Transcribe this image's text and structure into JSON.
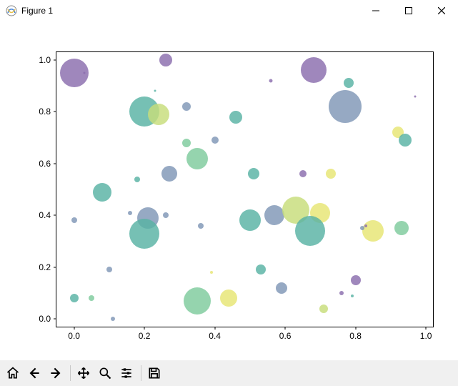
{
  "window": {
    "title": "Figure 1",
    "controls": {
      "minimize": "minimize",
      "maximize": "maximize",
      "close": "close"
    }
  },
  "toolbar": {
    "home": "home-icon",
    "back": "back-icon",
    "forward": "forward-icon",
    "pan": "pan-icon",
    "zoom": "zoom-icon",
    "subplots": "subplots-icon",
    "save": "save-icon"
  },
  "chart_data": {
    "type": "scatter",
    "xlabel": "",
    "ylabel": "",
    "title": "",
    "xlim": [
      -0.05,
      1.02
    ],
    "ylim": [
      -0.03,
      1.03
    ],
    "xticks": [
      0.0,
      0.2,
      0.4,
      0.6,
      0.8,
      1.0
    ],
    "yticks": [
      0.0,
      0.2,
      0.4,
      0.6,
      0.8,
      1.0
    ],
    "xtick_labels": [
      "0.0",
      "0.2",
      "0.4",
      "0.6",
      "0.8",
      "1.0"
    ],
    "ytick_labels": [
      "0.0",
      "0.2",
      "0.4",
      "0.6",
      "0.8",
      "1.0"
    ],
    "colors": {
      "purple": "#8a6cad",
      "teal": "#58b2a4",
      "bluegrey": "#7f96b6",
      "yellow": "#e7e573",
      "yellowgreen": "#c7dd7a",
      "green": "#7ecb9c"
    },
    "alpha": 0.82,
    "points": [
      {
        "x": 0.0,
        "y": 0.95,
        "size": 40,
        "color": "purple"
      },
      {
        "x": 0.03,
        "y": 0.95,
        "size": 3,
        "color": "purple"
      },
      {
        "x": 0.26,
        "y": 1.0,
        "size": 18,
        "color": "purple"
      },
      {
        "x": 0.23,
        "y": 0.88,
        "size": 3,
        "color": "teal"
      },
      {
        "x": 0.56,
        "y": 0.92,
        "size": 5,
        "color": "purple"
      },
      {
        "x": 0.68,
        "y": 0.96,
        "size": 36,
        "color": "purple"
      },
      {
        "x": 0.78,
        "y": 0.91,
        "size": 14,
        "color": "teal"
      },
      {
        "x": 0.97,
        "y": 0.86,
        "size": 3,
        "color": "purple"
      },
      {
        "x": 0.2,
        "y": 0.8,
        "size": 42,
        "color": "teal"
      },
      {
        "x": 0.24,
        "y": 0.79,
        "size": 30,
        "color": "yellowgreen"
      },
      {
        "x": 0.32,
        "y": 0.82,
        "size": 12,
        "color": "bluegrey"
      },
      {
        "x": 0.46,
        "y": 0.78,
        "size": 18,
        "color": "teal"
      },
      {
        "x": 0.77,
        "y": 0.82,
        "size": 46,
        "color": "bluegrey"
      },
      {
        "x": 0.92,
        "y": 0.72,
        "size": 16,
        "color": "yellow"
      },
      {
        "x": 0.94,
        "y": 0.69,
        "size": 18,
        "color": "teal"
      },
      {
        "x": 0.32,
        "y": 0.68,
        "size": 12,
        "color": "green"
      },
      {
        "x": 0.4,
        "y": 0.69,
        "size": 10,
        "color": "bluegrey"
      },
      {
        "x": 0.35,
        "y": 0.62,
        "size": 30,
        "color": "green"
      },
      {
        "x": 0.08,
        "y": 0.49,
        "size": 26,
        "color": "teal"
      },
      {
        "x": 0.18,
        "y": 0.54,
        "size": 8,
        "color": "teal"
      },
      {
        "x": 0.27,
        "y": 0.56,
        "size": 22,
        "color": "bluegrey"
      },
      {
        "x": 0.51,
        "y": 0.56,
        "size": 16,
        "color": "teal"
      },
      {
        "x": 0.65,
        "y": 0.56,
        "size": 10,
        "color": "purple"
      },
      {
        "x": 0.73,
        "y": 0.56,
        "size": 14,
        "color": "yellow"
      },
      {
        "x": 0.0,
        "y": 0.38,
        "size": 8,
        "color": "bluegrey"
      },
      {
        "x": 0.16,
        "y": 0.41,
        "size": 6,
        "color": "bluegrey"
      },
      {
        "x": 0.21,
        "y": 0.39,
        "size": 30,
        "color": "bluegrey"
      },
      {
        "x": 0.26,
        "y": 0.4,
        "size": 8,
        "color": "bluegrey"
      },
      {
        "x": 0.2,
        "y": 0.33,
        "size": 42,
        "color": "teal"
      },
      {
        "x": 0.36,
        "y": 0.36,
        "size": 8,
        "color": "bluegrey"
      },
      {
        "x": 0.5,
        "y": 0.38,
        "size": 30,
        "color": "teal"
      },
      {
        "x": 0.57,
        "y": 0.4,
        "size": 28,
        "color": "bluegrey"
      },
      {
        "x": 0.63,
        "y": 0.42,
        "size": 38,
        "color": "yellowgreen"
      },
      {
        "x": 0.7,
        "y": 0.41,
        "size": 28,
        "color": "yellow"
      },
      {
        "x": 0.67,
        "y": 0.34,
        "size": 42,
        "color": "teal"
      },
      {
        "x": 0.85,
        "y": 0.34,
        "size": 30,
        "color": "yellow"
      },
      {
        "x": 0.82,
        "y": 0.35,
        "size": 6,
        "color": "bluegrey"
      },
      {
        "x": 0.83,
        "y": 0.36,
        "size": 4,
        "color": "purple"
      },
      {
        "x": 0.93,
        "y": 0.35,
        "size": 20,
        "color": "green"
      },
      {
        "x": 0.39,
        "y": 0.18,
        "size": 4,
        "color": "yellow"
      },
      {
        "x": 0.1,
        "y": 0.19,
        "size": 8,
        "color": "bluegrey"
      },
      {
        "x": 0.53,
        "y": 0.19,
        "size": 14,
        "color": "teal"
      },
      {
        "x": 0.59,
        "y": 0.12,
        "size": 16,
        "color": "bluegrey"
      },
      {
        "x": 0.8,
        "y": 0.15,
        "size": 14,
        "color": "purple"
      },
      {
        "x": 0.76,
        "y": 0.1,
        "size": 6,
        "color": "purple"
      },
      {
        "x": 0.79,
        "y": 0.09,
        "size": 4,
        "color": "teal"
      },
      {
        "x": 0.0,
        "y": 0.08,
        "size": 12,
        "color": "teal"
      },
      {
        "x": 0.05,
        "y": 0.08,
        "size": 8,
        "color": "green"
      },
      {
        "x": 0.35,
        "y": 0.07,
        "size": 38,
        "color": "green"
      },
      {
        "x": 0.44,
        "y": 0.08,
        "size": 24,
        "color": "yellow"
      },
      {
        "x": 0.71,
        "y": 0.04,
        "size": 12,
        "color": "yellowgreen"
      },
      {
        "x": 0.11,
        "y": 0.0,
        "size": 6,
        "color": "bluegrey"
      }
    ]
  }
}
